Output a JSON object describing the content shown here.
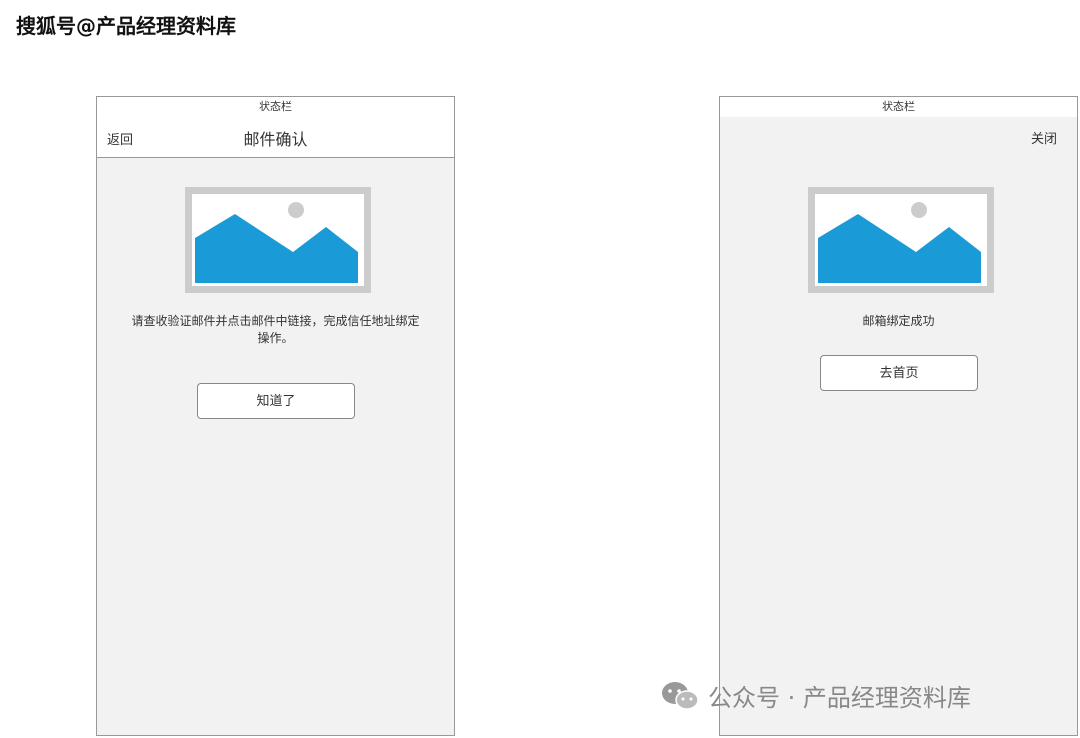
{
  "watermark_top": "搜狐号@产品经理资料库",
  "watermark_bottom": "公众号 · 产品经理资料库",
  "left_screen": {
    "status_bar": "状态栏",
    "back_label": "返回",
    "title": "邮件确认",
    "image_icon": "image-placeholder-icon",
    "message": "请查收验证邮件并点击邮件中链接，完成信任地址绑定操作。",
    "button_label": "知道了"
  },
  "right_screen": {
    "status_bar": "状态栏",
    "close_label": "关闭",
    "image_icon": "image-placeholder-icon",
    "message": "邮箱绑定成功",
    "button_label": "去首页"
  },
  "colors": {
    "mountain": "#1a9bd7",
    "image_frame": "#cccccc",
    "screen_bg": "#f2f2f2"
  }
}
